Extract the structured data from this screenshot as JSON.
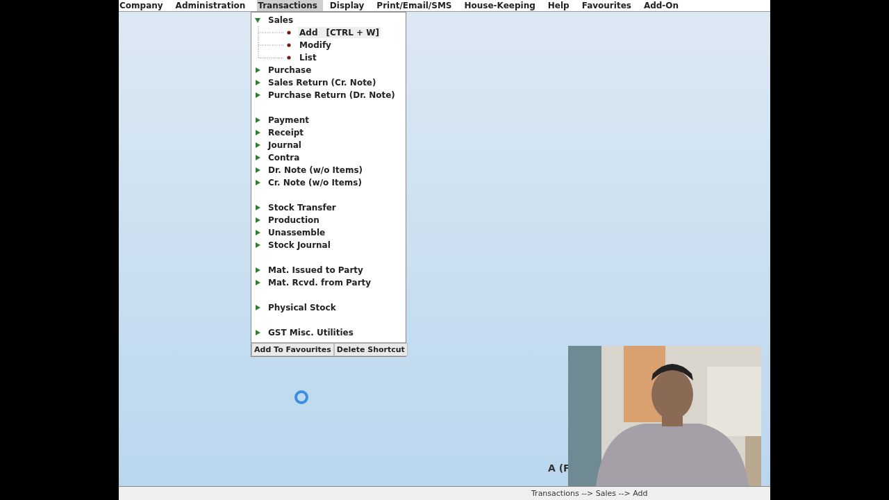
{
  "menu_bar": [
    {
      "label": "Company",
      "selected": false
    },
    {
      "label": "Administration",
      "selected": false
    },
    {
      "label": "Transactions",
      "selected": true
    },
    {
      "label": "Display",
      "selected": false
    },
    {
      "label": "Print/Email/SMS",
      "selected": false
    },
    {
      "label": "House-Keeping",
      "selected": false
    },
    {
      "label": "Help",
      "selected": false
    },
    {
      "label": "Favourites",
      "selected": false
    },
    {
      "label": "Add-On",
      "selected": false
    }
  ],
  "transactions_menu": {
    "groups": [
      [
        {
          "label": "Sales",
          "expanded": true,
          "children": [
            {
              "label": "Add",
              "shortcut": "[CTRL + W]",
              "selected": true
            },
            {
              "label": "Modify",
              "selected": false
            },
            {
              "label": "List",
              "selected": false
            }
          ]
        },
        {
          "label": "Purchase",
          "expanded": false
        },
        {
          "label": "Sales Return (Cr. Note)",
          "expanded": false
        },
        {
          "label": "Purchase Return (Dr. Note)",
          "expanded": false
        }
      ],
      [
        {
          "label": "Payment",
          "expanded": false
        },
        {
          "label": "Receipt",
          "expanded": false
        },
        {
          "label": "Journal",
          "expanded": false
        },
        {
          "label": "Contra",
          "expanded": false
        },
        {
          "label": "Dr. Note (w/o Items)",
          "expanded": false
        },
        {
          "label": "Cr. Note (w/o Items)",
          "expanded": false
        }
      ],
      [
        {
          "label": "Stock Transfer",
          "expanded": false
        },
        {
          "label": "Production",
          "expanded": false
        },
        {
          "label": "Unassemble",
          "expanded": false
        },
        {
          "label": "Stock Journal",
          "expanded": false
        }
      ],
      [
        {
          "label": "Mat. Issued to Party",
          "expanded": false
        },
        {
          "label": "Mat. Rcvd. from Party",
          "expanded": false
        }
      ],
      [
        {
          "label": "Physical Stock",
          "expanded": false
        }
      ],
      [
        {
          "label": "GST Misc. Utilities",
          "expanded": false
        }
      ]
    ],
    "buttons": [
      "Add To Favourites",
      "Delete Shortcut"
    ]
  },
  "background_text": "A (F",
  "status_bar": {
    "path": "Transactions --> Sales --> Add"
  }
}
